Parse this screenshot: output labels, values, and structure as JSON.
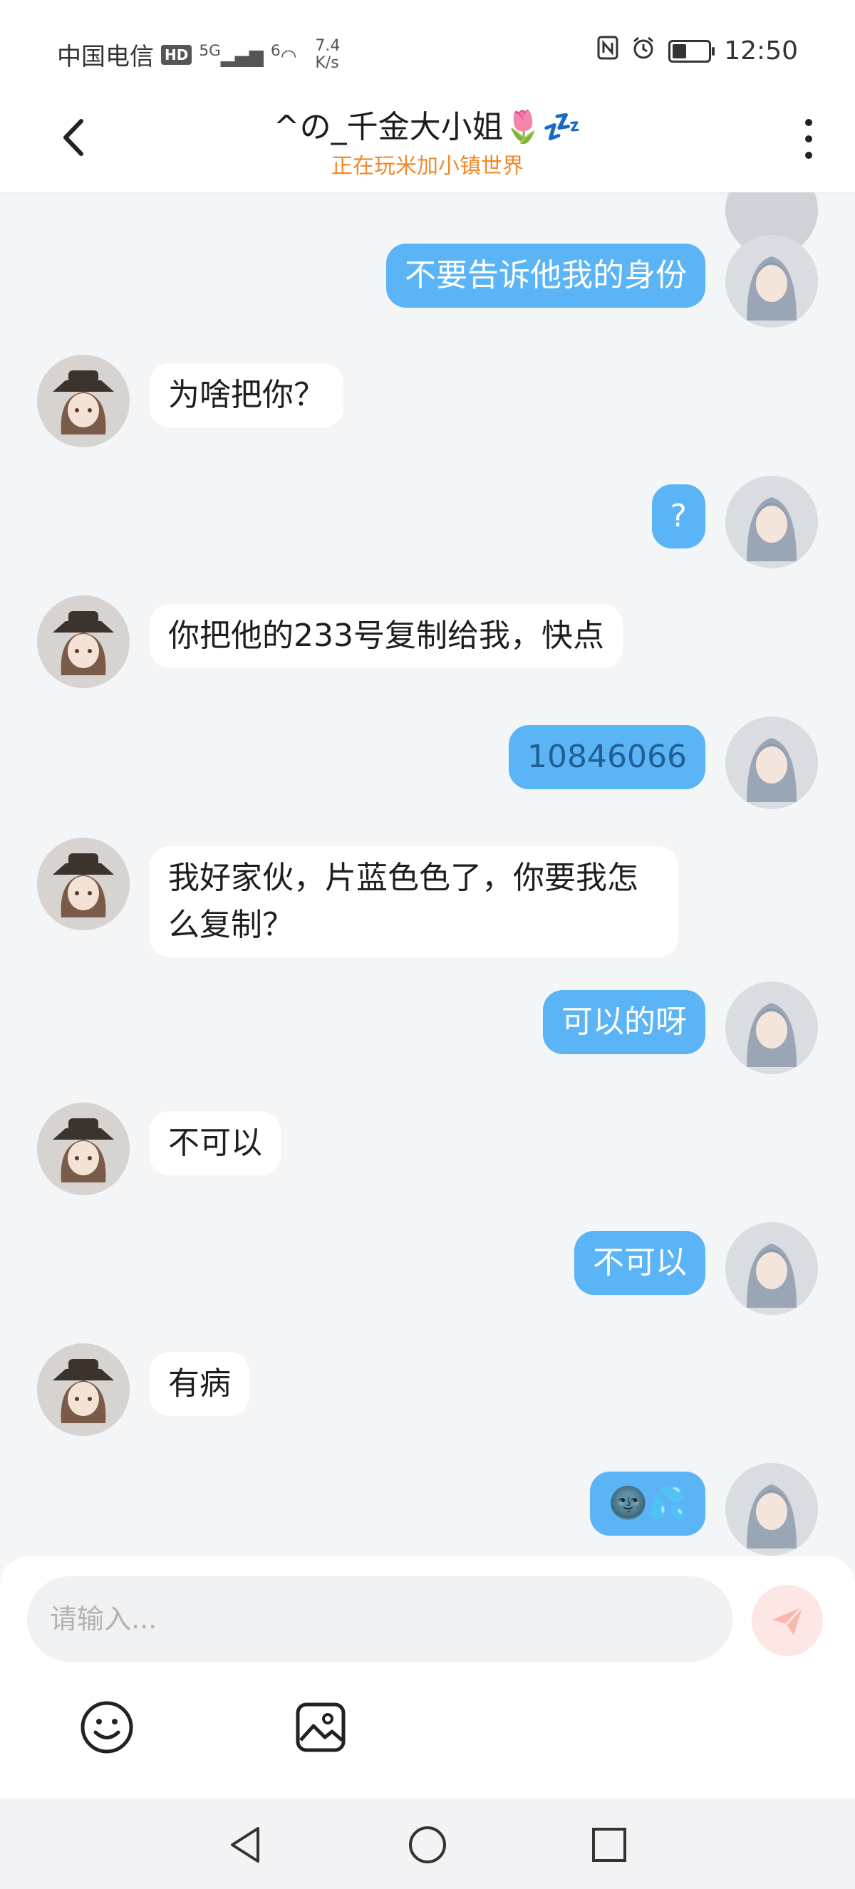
{
  "status_bar": {
    "carrier": "中国电信",
    "hd": "HD",
    "network": "5G",
    "network2": "6",
    "speed_value": "7.4",
    "speed_unit": "K/s",
    "time": "12:50",
    "battery_level": 0.4
  },
  "header": {
    "title": "^の_千金大小姐🌷💤",
    "subtitle": "正在玩米加小镇世界"
  },
  "messages": [
    {
      "side": "me",
      "text": "不要告诉他我的身份"
    },
    {
      "side": "other",
      "text": "为啥把你？"
    },
    {
      "side": "me",
      "text": "?"
    },
    {
      "side": "other",
      "text": "你把他的233号复制给我，快点"
    },
    {
      "side": "me",
      "text": "10846066"
    },
    {
      "side": "other",
      "text": "我好家伙，片蓝色色了，你要我怎么复制？"
    },
    {
      "side": "me",
      "text": "可以的呀"
    },
    {
      "side": "other",
      "text": "不可以"
    },
    {
      "side": "me",
      "text": "不可以"
    },
    {
      "side": "other",
      "text": "有病"
    },
    {
      "side": "me",
      "text": "🌚💦"
    }
  ],
  "composer": {
    "placeholder": "请输入..."
  },
  "icons": {
    "back": "chevron-left-icon",
    "more": "more-vertical-icon",
    "send": "send-icon",
    "emoji": "smiley-icon",
    "image": "image-icon",
    "nav_back": "triangle-back-icon",
    "nav_home": "circle-home-icon",
    "nav_recent": "square-recent-icon"
  },
  "colors": {
    "my_bubble": "#5ab4f5",
    "other_bubble": "#ffffff",
    "subtitle": "#f08a2a",
    "background": "#f3f5f7"
  }
}
